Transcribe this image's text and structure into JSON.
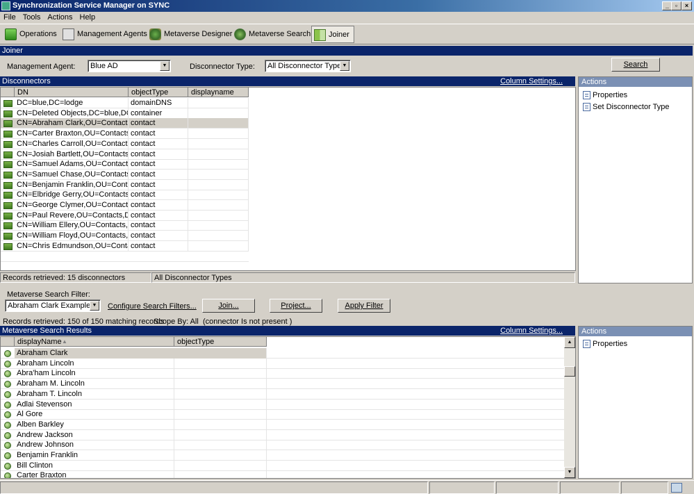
{
  "window": {
    "title": "Synchronization Service Manager on SYNC"
  },
  "menu": [
    "File",
    "Tools",
    "Actions",
    "Help"
  ],
  "toolbar": [
    {
      "label": "Operations",
      "icon": "operations-icon"
    },
    {
      "label": "Management Agents",
      "icon": "management-agents-icon"
    },
    {
      "label": "Metaverse Designer",
      "icon": "metaverse-designer-icon"
    },
    {
      "label": "Metaverse Search",
      "icon": "metaverse-search-icon"
    },
    {
      "label": "Joiner",
      "icon": "joiner-icon",
      "active": true
    }
  ],
  "joiner": {
    "section_title": "Joiner",
    "ma_label": "Management Agent:",
    "ma_value": "Blue AD",
    "dtype_label": "Disconnector Type:",
    "dtype_value": "All Disconnector Types",
    "search_button": "Search"
  },
  "disconnectors": {
    "title": "Disconnectors",
    "column_settings": "Column Settings...",
    "columns": [
      "DN",
      "objectType",
      "displayname"
    ],
    "rows": [
      [
        "DC=blue,DC=lodge",
        "domainDNS",
        ""
      ],
      [
        "CN=Deleted Objects,DC=blue,DC=l...",
        "container",
        ""
      ],
      [
        "CN=Abraham Clark,OU=Contacts,D...",
        "contact",
        ""
      ],
      [
        "CN=Carter Braxton,OU=Contacts,D...",
        "contact",
        ""
      ],
      [
        "CN=Charles Carroll,OU=Contacts,D...",
        "contact",
        ""
      ],
      [
        "CN=Josiah Bartlett,OU=Contacts,D...",
        "contact",
        ""
      ],
      [
        "CN=Samuel Adams,OU=Contacts,D...",
        "contact",
        ""
      ],
      [
        "CN=Samuel Chase,OU=Contacts,D...",
        "contact",
        ""
      ],
      [
        "CN=Benjamin Franklin,OU=Contact...",
        "contact",
        ""
      ],
      [
        "CN=Elbridge Gerry,OU=Contacts,D...",
        "contact",
        ""
      ],
      [
        "CN=George Clymer,OU=Contacts,D...",
        "contact",
        ""
      ],
      [
        "CN=Paul Revere,OU=Contacts,DC...",
        "contact",
        ""
      ],
      [
        "CN=William Ellery,OU=Contacts,D...",
        "contact",
        ""
      ],
      [
        "CN=William Floyd,OU=Contacts,DC...",
        "contact",
        ""
      ],
      [
        "CN=Chris Edmundson,OU=Contact...",
        "contact",
        ""
      ]
    ],
    "status_left": "Records retrieved: 15 disconnectors",
    "status_right": "All Disconnector Types",
    "actions_title": "Actions",
    "actions": [
      "Properties",
      "Set Disconnector Type"
    ]
  },
  "filter": {
    "label": "Metaverse Search Filter:",
    "value": "Abraham Clark Example",
    "configure": "Configure Search Filters...",
    "join": "Join...",
    "project": "Project...",
    "apply": "Apply Filter",
    "records": "Records retrieved: 150 of 150 matching records",
    "scope": "Scope By: All",
    "condition": "(connector Is not present )"
  },
  "results": {
    "title": "Metaverse Search Results",
    "column_settings": "Column Settings...",
    "columns": [
      "displayName",
      "objectType"
    ],
    "rows": [
      "Abraham Clark",
      "Abraham Lincoln",
      "Abra'ham Lincoln",
      "Abraham M. Lincoln",
      "Abraham T. Lincoln",
      "Adlai Stevenson",
      "Al Gore",
      "Alben Barkley",
      "Andrew Jackson",
      "Andrew Johnson",
      "Benjamin Franklin",
      "Bill Clinton",
      "Carter Braxton"
    ],
    "actions_title": "Actions",
    "actions": [
      "Properties"
    ]
  }
}
